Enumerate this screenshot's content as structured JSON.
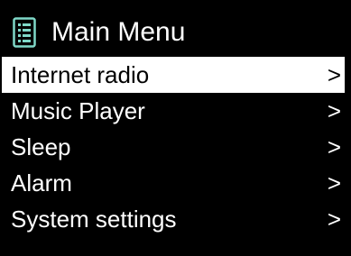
{
  "header": {
    "icon": "list-menu-icon",
    "title": "Main Menu"
  },
  "menu": {
    "selected_index": 0,
    "items": [
      {
        "label": "Internet radio",
        "arrow": ">"
      },
      {
        "label": "Music Player",
        "arrow": ">"
      },
      {
        "label": "Sleep",
        "arrow": ">"
      },
      {
        "label": "Alarm",
        "arrow": ">"
      },
      {
        "label": "System settings",
        "arrow": ">"
      }
    ]
  },
  "colors": {
    "background": "#000000",
    "foreground": "#ffffff",
    "icon_accent": "#7fd8c8",
    "selection_background": "#ffffff",
    "selection_text": "#000000"
  }
}
